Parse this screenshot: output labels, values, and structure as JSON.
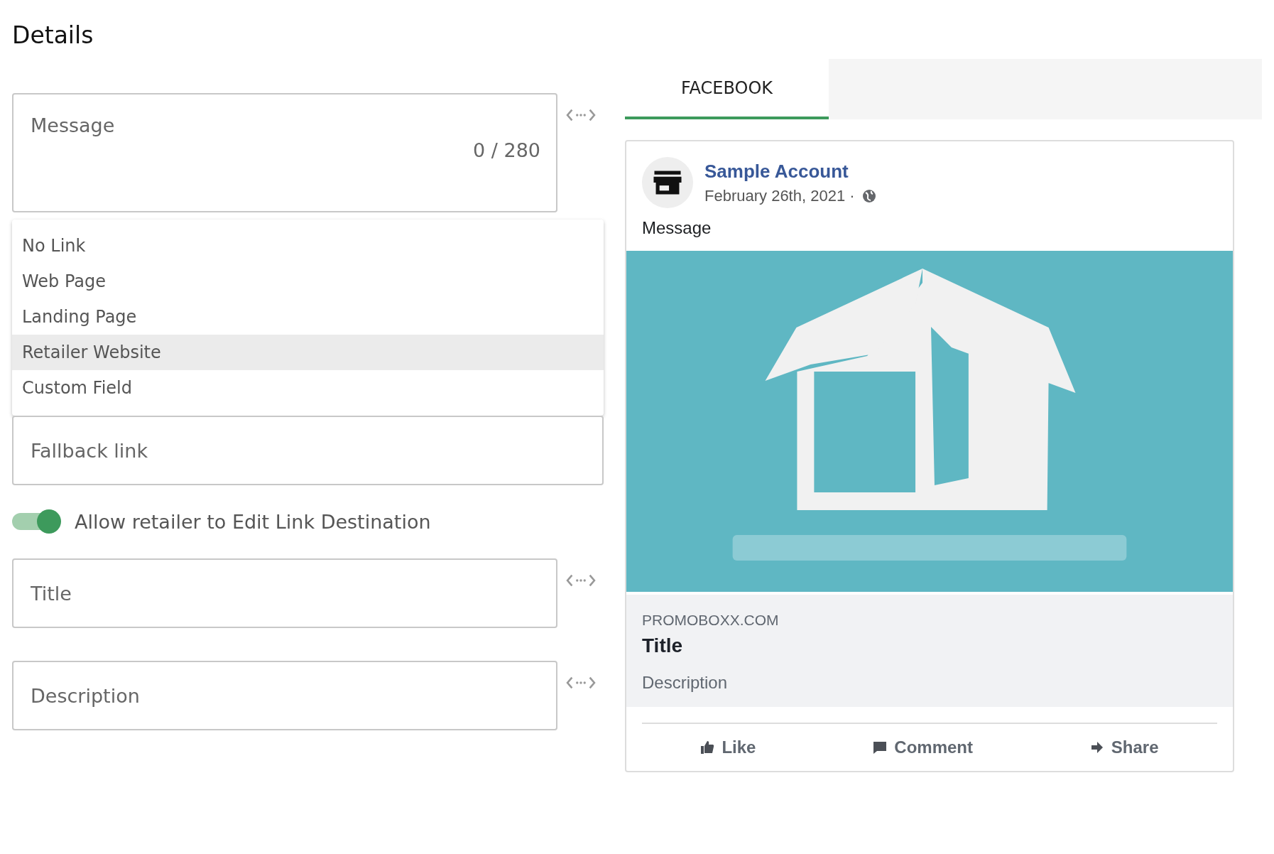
{
  "heading": "Details",
  "message": {
    "placeholder": "Message",
    "counter": "0 / 280"
  },
  "link_options": [
    {
      "label": "No Link",
      "selected": false
    },
    {
      "label": "Web Page",
      "selected": false
    },
    {
      "label": "Landing Page",
      "selected": false
    },
    {
      "label": "Retailer Website",
      "selected": true
    },
    {
      "label": "Custom Field",
      "selected": false
    }
  ],
  "fallback_link": {
    "placeholder": "Fallback link"
  },
  "allow_edit_toggle": {
    "label": "Allow retailer to Edit Link Destination",
    "on": true
  },
  "title_field": {
    "placeholder": "Title"
  },
  "description_field": {
    "placeholder": "Description"
  },
  "tabs": [
    {
      "label": "FACEBOOK",
      "selected": true
    }
  ],
  "post": {
    "account": "Sample Account",
    "date": "February 26th, 2021 ·",
    "message": "Message",
    "domain": "PROMOBOXX.COM",
    "title": "Title",
    "description": "Description",
    "actions": [
      {
        "kind": "like",
        "label": "Like"
      },
      {
        "kind": "comment",
        "label": "Comment"
      },
      {
        "kind": "share",
        "label": "Share"
      }
    ]
  }
}
